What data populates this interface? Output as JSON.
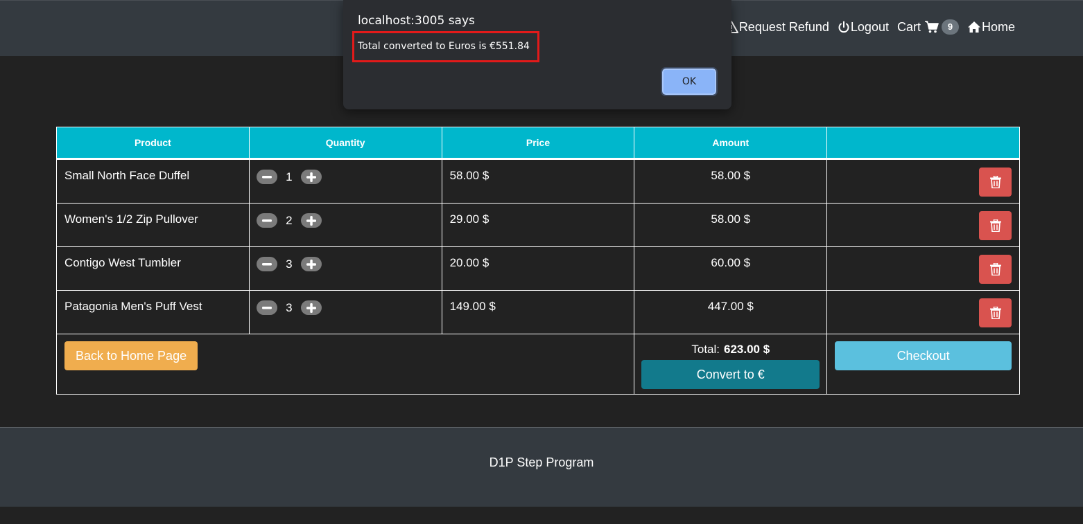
{
  "nav": {
    "request_refund": "Request Refund",
    "logout": "Logout",
    "cart": "Cart",
    "cart_count": "9",
    "home": "Home"
  },
  "table": {
    "headers": [
      "Product",
      "Quantity",
      "Price",
      "Amount",
      ""
    ],
    "rows": [
      {
        "product": "Small North Face Duffel",
        "quantity": "1",
        "price": "58.00 $",
        "amount": "58.00 $"
      },
      {
        "product": "Women's 1/2 Zip Pullover",
        "quantity": "2",
        "price": "29.00 $",
        "amount": "58.00 $"
      },
      {
        "product": "Contigo West Tumbler",
        "quantity": "3",
        "price": "20.00 $",
        "amount": "60.00 $"
      },
      {
        "product": "Patagonia Men's Puff Vest",
        "quantity": "3",
        "price": "149.00 $",
        "amount": "447.00 $"
      }
    ]
  },
  "actions": {
    "back_home": "Back to Home Page",
    "total_label": "Total:",
    "total_value": "623.00 $",
    "convert": "Convert to €",
    "checkout": "Checkout"
  },
  "footer": {
    "text": "D1P Step Program"
  },
  "dialog": {
    "title": "localhost:3005 says",
    "message": "Total converted to Euros is €551.84",
    "ok": "OK"
  },
  "colors": {
    "header_cyan": "#00b7cc",
    "delete_red": "#d9534f",
    "home_orange": "#f0ad4e",
    "convert_teal": "#127a8c",
    "checkout_blue": "#5bc0de",
    "highlight_red": "#e21a1a"
  }
}
